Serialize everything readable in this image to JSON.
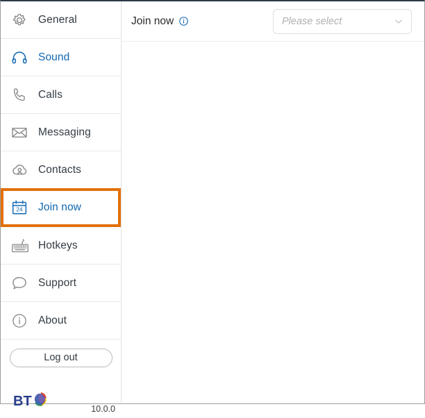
{
  "sidebar": {
    "items": [
      {
        "id": "general",
        "label": "General",
        "icon": "gear-icon",
        "state": "default"
      },
      {
        "id": "sound",
        "label": "Sound",
        "icon": "headphones-icon",
        "state": "active"
      },
      {
        "id": "calls",
        "label": "Calls",
        "icon": "phone-icon",
        "state": "default"
      },
      {
        "id": "messaging",
        "label": "Messaging",
        "icon": "envelope-icon",
        "state": "default"
      },
      {
        "id": "contacts",
        "label": "Contacts",
        "icon": "cloud-contacts-icon",
        "state": "default"
      },
      {
        "id": "join-now",
        "label": "Join now",
        "icon": "calendar-24-icon",
        "state": "selected"
      },
      {
        "id": "hotkeys",
        "label": "Hotkeys",
        "icon": "keyboard-icon",
        "state": "default"
      },
      {
        "id": "support",
        "label": "Support",
        "icon": "chat-bubble-icon",
        "state": "default"
      },
      {
        "id": "about",
        "label": "About",
        "icon": "info-circle-icon",
        "state": "default"
      }
    ],
    "logout_label": "Log out",
    "brand": "BT",
    "version": "10.0.0"
  },
  "main": {
    "title": "Join now",
    "info_icon": "info-circle-icon",
    "select": {
      "value": "Please select",
      "placeholder": "Please select",
      "chevron": "chevron-down-icon"
    }
  },
  "colors": {
    "accent_blue": "#1268b3",
    "highlight_orange": "#e2700a",
    "text": "#333c44",
    "icon_gray": "#8a8a8a",
    "divider": "#e8e8e8"
  }
}
